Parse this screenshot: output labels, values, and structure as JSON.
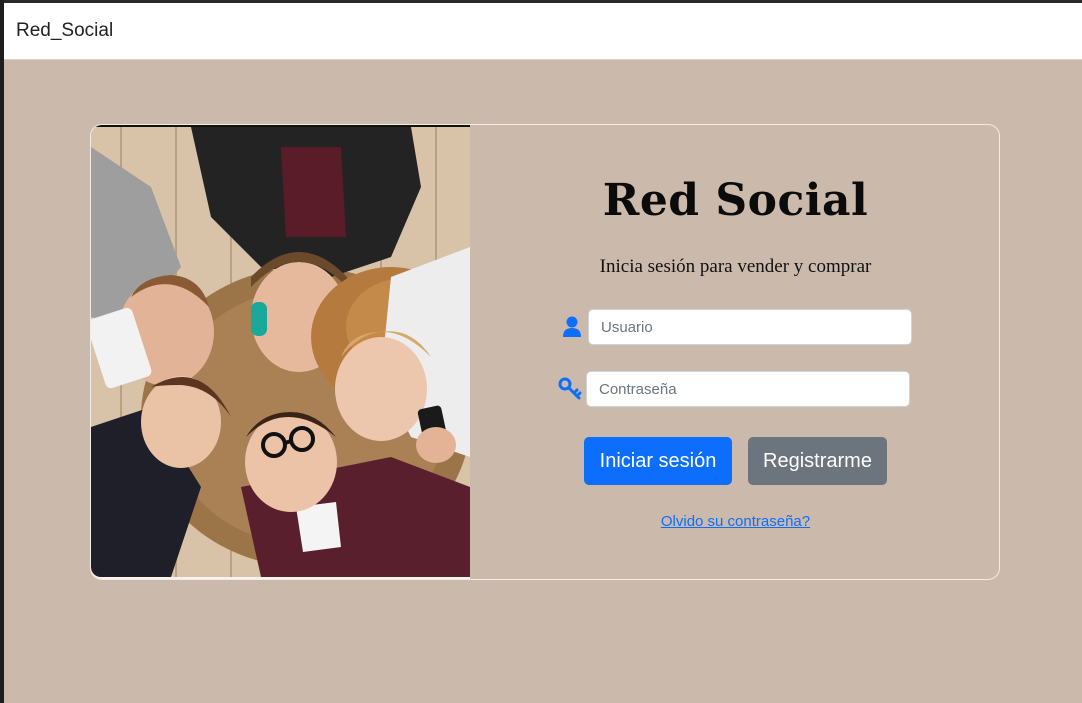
{
  "window": {
    "title": "Red_Social"
  },
  "photo": {
    "description_icon": "group-photo"
  },
  "login": {
    "brand": "Red Social",
    "subtitle": "Inicia sesión para vender y comprar",
    "username": {
      "placeholder": "Usuario",
      "value": "",
      "icon": "user-icon"
    },
    "password": {
      "placeholder": "Contraseña",
      "value": "",
      "icon": "key-icon"
    },
    "login_button": "Iniciar sesión",
    "register_button": "Registrarme",
    "forgot_link": "Olvido su contraseña?"
  },
  "colors": {
    "background": "#cbbaac",
    "primary": "#0d6efd",
    "secondary": "#6c757d",
    "icon": "#0d6efd"
  }
}
